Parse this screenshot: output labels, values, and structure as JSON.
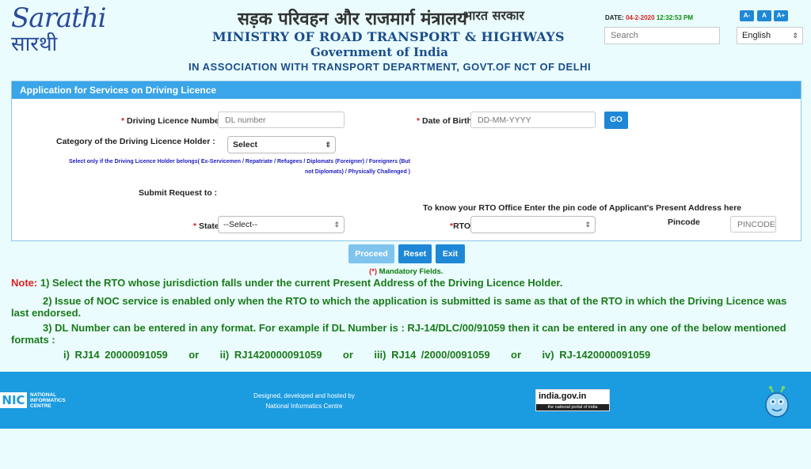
{
  "header": {
    "logo_text_1": "Sarathi",
    "logo_text_2": "सारथी",
    "hindi_title": "सड़क परिवहन और राजमार्ग मंत्रालय",
    "hindi_gov": "भारत सरकार",
    "ministry": "MINISTRY OF ROAD TRANSPORT & HIGHWAYS",
    "government": "Government of India",
    "association": "IN ASSOCIATION WITH TRANSPORT DEPARTMENT, GOVT.OF NCT OF DELHI",
    "date_label": "DATE:",
    "date": "04-2-2020",
    "time": "12:32:53 PM",
    "font_buttons": [
      "A-",
      "A",
      "A+"
    ],
    "search_placeholder": "Search",
    "language": "English"
  },
  "form": {
    "title": "Application for Services on Driving Licence",
    "dl_label": "Driving Licence Number",
    "dl_placeholder": "DL number",
    "dob_label": "Date of Birth",
    "dob_placeholder": "DD-MM-YYYY",
    "go_label": "GO",
    "category_label": "Category of the Driving Licence Holder :",
    "category_value": "Select",
    "category_note_1": "Select only if the Driving Licence Holder belongs( Ex-Servicemen / Repatriate / Refugees / Diplomats (Foreigner) / Foreigners (But",
    "category_note_2": "not Diplomats) / Physically Challenged )",
    "submit_to_label": "Submit Request to :",
    "rto_hint": "To know your RTO Office Enter the pin code of Applicant's Present Address here",
    "state_label": "State",
    "state_value": "--Select--",
    "rto_label": "RTO",
    "rto_value": "",
    "pincode_label": "Pincode",
    "pincode_placeholder": "PINCODE",
    "required_mark": "*"
  },
  "actions": {
    "proceed": "Proceed",
    "reset": "Reset",
    "exit": "Exit",
    "mandatory_star": "(*)",
    "mandatory_text": "Mandatory Fields."
  },
  "notes": {
    "label": "Note:",
    "n1": "1) Select the RTO whose jurisdiction falls under the current Present Address of the Driving Licence Holder.",
    "n2": "2) Issue of NOC service is enabled only when the RTO to which the application is submitted is same as that of the RTO in which the Driving Licence was last endorsed.",
    "n3": "3) DL Number can be entered in any format. For example if DL Number is : RJ-14/DLC/00/91059 then it can be entered in any one of the below mentioned formats :",
    "n4": "i) RJ14 20000091059    or    ii) RJ1420000091059    or    iii) RJ14 /2000/0091059    or    iv) RJ-1420000091059"
  },
  "footer": {
    "nic_mark": "NIC",
    "nic_text": "NATIONAL INFORMATICS CENTRE",
    "credit_1": "Designed, developed and hosted by",
    "credit_2": "National Informatics Centre",
    "indiagov_1": "india.gov.in",
    "indiagov_2": "the national portal of india"
  },
  "colors": {
    "accent": "#1e88d6",
    "panel_header": "#3aa5e8",
    "footer": "#1b9be0",
    "note_green": "#1a7a1a",
    "required_red": "#e02020"
  }
}
